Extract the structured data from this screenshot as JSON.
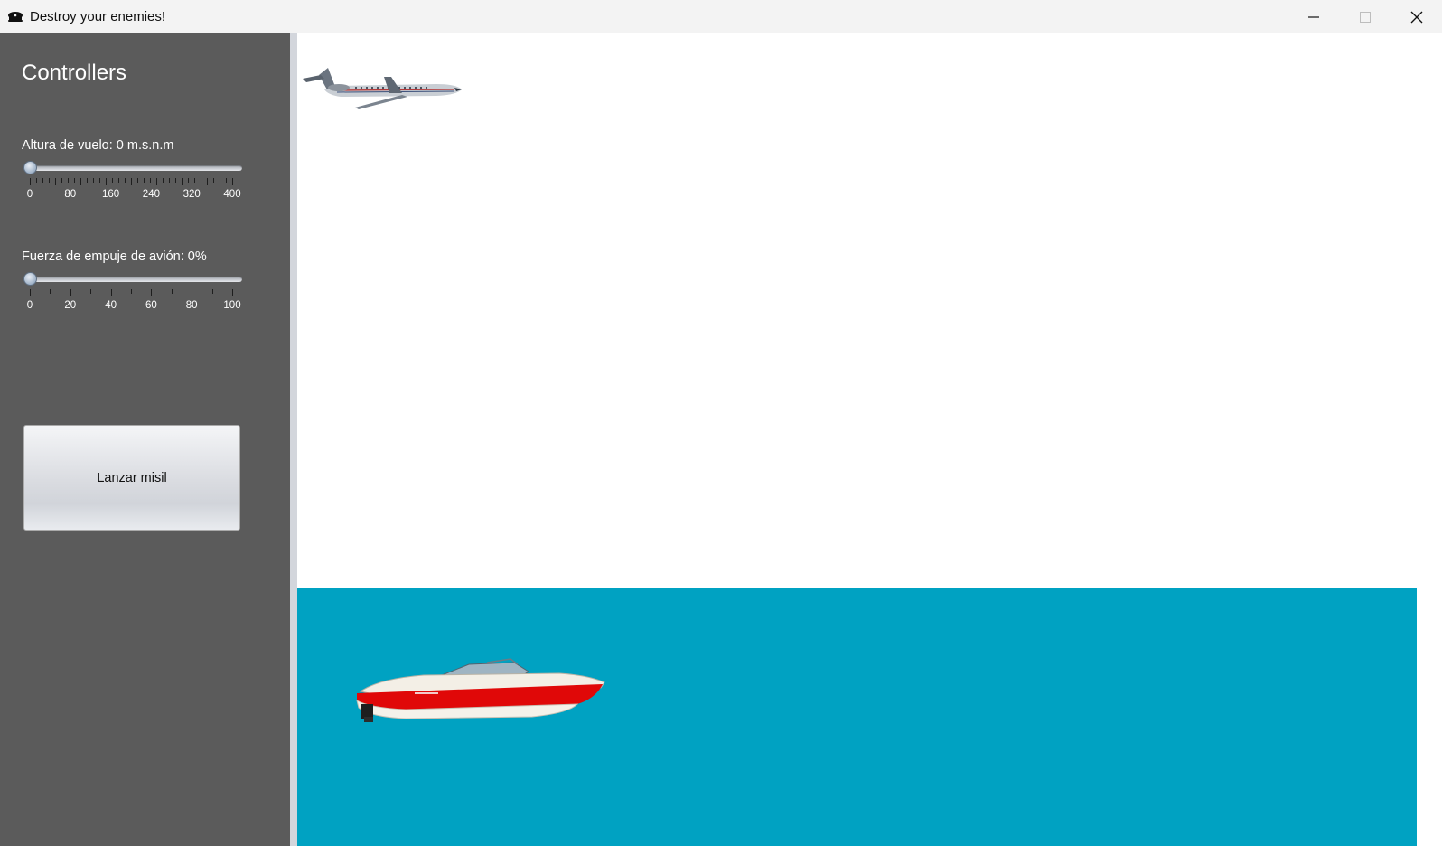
{
  "window": {
    "title": "Destroy your enemies!",
    "app_icon": "pilot-cap-icon",
    "controls": {
      "minimize": "minimize-icon",
      "maximize": "maximize-icon",
      "close": "close-icon"
    }
  },
  "sidebar": {
    "heading": "Controllers",
    "altitude": {
      "label": "Altura de vuelo: 0 m.s.n.m",
      "value": 0,
      "min": 0,
      "max": 400,
      "tick_labels": [
        "0",
        "80",
        "160",
        "240",
        "320",
        "400"
      ]
    },
    "thrust": {
      "label": "Fuerza de empuje de avión: 0%",
      "value": 0,
      "min": 0,
      "max": 100,
      "tick_labels": [
        "0",
        "20",
        "40",
        "60",
        "80",
        "100"
      ]
    },
    "launch_button": "Lanzar misil"
  },
  "scene": {
    "sky_color": "#ffffff",
    "sea_color": "#00a2c2",
    "sidebar_color": "#5b5b5b",
    "objects": [
      "airplane",
      "speedboat"
    ]
  }
}
